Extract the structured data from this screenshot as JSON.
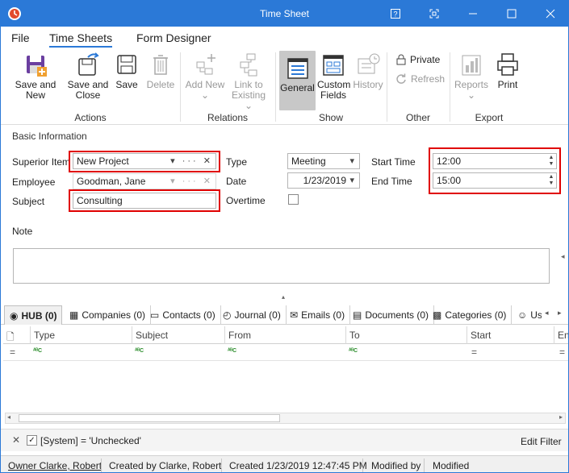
{
  "window": {
    "title": "Time Sheet",
    "accent_color": "#2b79d7"
  },
  "menu": {
    "tabs": [
      "File",
      "Time Sheets",
      "Form Designer"
    ],
    "active": "Time Sheets"
  },
  "ribbon": {
    "actions": {
      "group_label": "Actions",
      "save_and_new": "Save and New",
      "save_and_close_1": "Save and",
      "save_and_close_2": "Close",
      "save": "Save",
      "delete": "Delete"
    },
    "relations": {
      "group_label": "Relations",
      "add_new": "Add New",
      "link_to_1": "Link to",
      "link_to_2": "Existing"
    },
    "show": {
      "group_label": "Show",
      "general": "General",
      "custom_fields_1": "Custom",
      "custom_fields_2": "Fields",
      "history": "History"
    },
    "other": {
      "group_label": "Other",
      "private": "Private",
      "refresh": "Refresh"
    },
    "export": {
      "group_label": "Export",
      "reports": "Reports",
      "print": "Print"
    }
  },
  "form": {
    "section": "Basic Information",
    "superior_item_label": "Superior Item",
    "superior_item_value": "New Project",
    "employee_label": "Employee",
    "employee_value": "Goodman, Jane",
    "subject_label": "Subject",
    "subject_value": "Consulting",
    "type_label": "Type",
    "type_value": "Meeting",
    "date_label": "Date",
    "date_value": "1/23/2019",
    "overtime_label": "Overtime",
    "overtime_checked": false,
    "start_time_label": "Start Time",
    "start_time_value": "12:00",
    "end_time_label": "End Time",
    "end_time_value": "15:00",
    "note_label": "Note",
    "highlight_color": "#e00000"
  },
  "tabs": [
    {
      "label": "HUB (0)",
      "icon": "hub-icon"
    },
    {
      "label": "Companies (0)",
      "icon": "building-icon"
    },
    {
      "label": "Contacts (0)",
      "icon": "contact-card-icon"
    },
    {
      "label": "Journal (0)",
      "icon": "journal-icon"
    },
    {
      "label": "Emails (0)",
      "icon": "envelope-icon"
    },
    {
      "label": "Documents (0)",
      "icon": "document-icon"
    },
    {
      "label": "Categories (0)",
      "icon": "categories-icon"
    },
    {
      "label": "Us",
      "icon": "users-icon"
    }
  ],
  "grid": {
    "columns": [
      "Type",
      "Subject",
      "From",
      "To",
      "Start",
      "En"
    ]
  },
  "filter": {
    "text": "[System] = 'Unchecked'",
    "edit": "Edit Filter"
  },
  "status": {
    "owner": "Owner Clarke, Robert",
    "created_by": "Created by Clarke, Robert",
    "created": "Created 1/23/2019 12:47:45 PM",
    "modified_by": "Modified by",
    "modified": "Modified"
  }
}
